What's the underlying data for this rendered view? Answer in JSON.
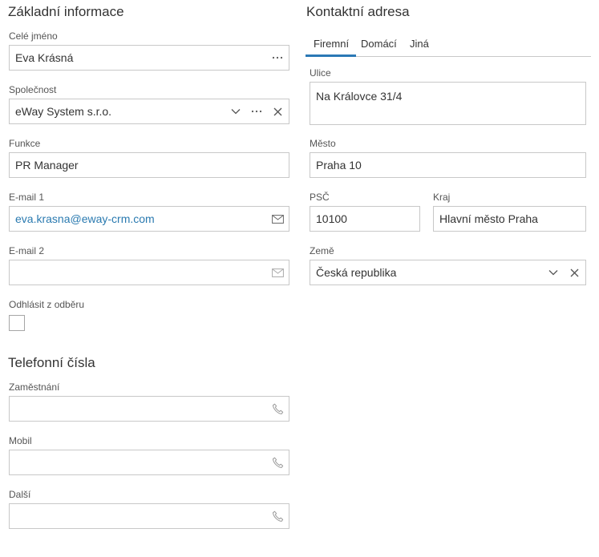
{
  "basic": {
    "title": "Základní informace",
    "full_name_label": "Celé jméno",
    "full_name_value": "Eva Krásná",
    "company_label": "Společnost",
    "company_value": "eWay System s.r.o.",
    "function_label": "Funkce",
    "function_value": "PR Manager",
    "email1_label": "E-mail 1",
    "email1_value": "eva.krasna@eway-crm.com",
    "email2_label": "E-mail 2",
    "email2_value": "",
    "unsubscribe_label": "Odhlásit z odběru",
    "unsubscribe_checked": false
  },
  "phones": {
    "title": "Telefonní čísla",
    "work_label": "Zaměstnání",
    "work_value": "",
    "mobile_label": "Mobil",
    "mobile_value": "",
    "other_label": "Další",
    "other_value": ""
  },
  "address": {
    "title": "Kontaktní adresa",
    "tabs": [
      {
        "label": "Firemní",
        "active": true
      },
      {
        "label": "Domácí",
        "active": false
      },
      {
        "label": "Jiná",
        "active": false
      }
    ],
    "street_label": "Ulice",
    "street_value": "Na Královce 31/4",
    "city_label": "Město",
    "city_value": "Praha 10",
    "zip_label": "PSČ",
    "zip_value": "10100",
    "region_label": "Kraj",
    "region_value": "Hlavní město Praha",
    "country_label": "Země",
    "country_value": "Česká republika"
  },
  "icons": {
    "more": "ellipsis-icon",
    "dropdown": "chevron-down-icon",
    "clear": "close-icon",
    "email": "envelope-icon",
    "phone": "phone-icon"
  },
  "colors": {
    "accent": "#2b78b5",
    "link": "#2a7ab0",
    "border": "#c8c8c8"
  }
}
